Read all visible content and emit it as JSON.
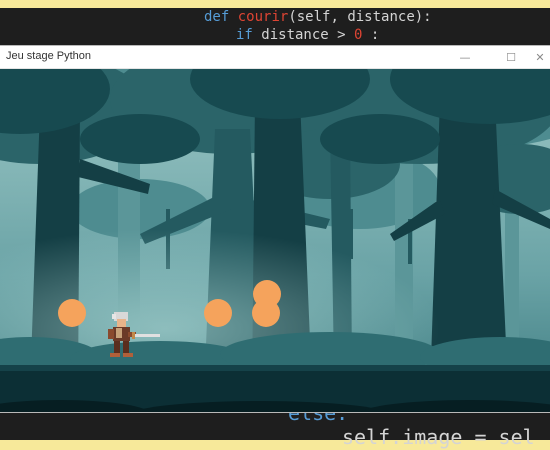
{
  "editor": {
    "top_line_1": {
      "kw": "def",
      "fn": "courir",
      "rest": "(self, distance):"
    },
    "top_line_2": {
      "kw": "if",
      "rest": " distance > ",
      "num": "0",
      "tail": " :"
    },
    "bottom_line_1": "else:",
    "bottom_line_2": "self.image = sel"
  },
  "window": {
    "title": "Jeu stage Python",
    "buttons": {
      "minimize": "—",
      "maximize": "☐",
      "close": "✕"
    }
  },
  "game": {
    "player": {
      "name": "swordsman-player",
      "facing": "right"
    },
    "projectiles": [
      {
        "id": "ball-1",
        "color": "#f5a35c"
      },
      {
        "id": "ball-2",
        "color": "#f5a35c"
      },
      {
        "id": "ball-3",
        "color": "#f5a35c"
      },
      {
        "id": "ball-4",
        "color": "#f5a35c"
      }
    ],
    "colors": {
      "sky": "#7fb2b3",
      "trees_far": "#5b9699",
      "trees_mid": "#2f6d72",
      "trees_near": "#14454b",
      "ground": "#0c2f35",
      "projectile": "#f5a35c"
    }
  }
}
